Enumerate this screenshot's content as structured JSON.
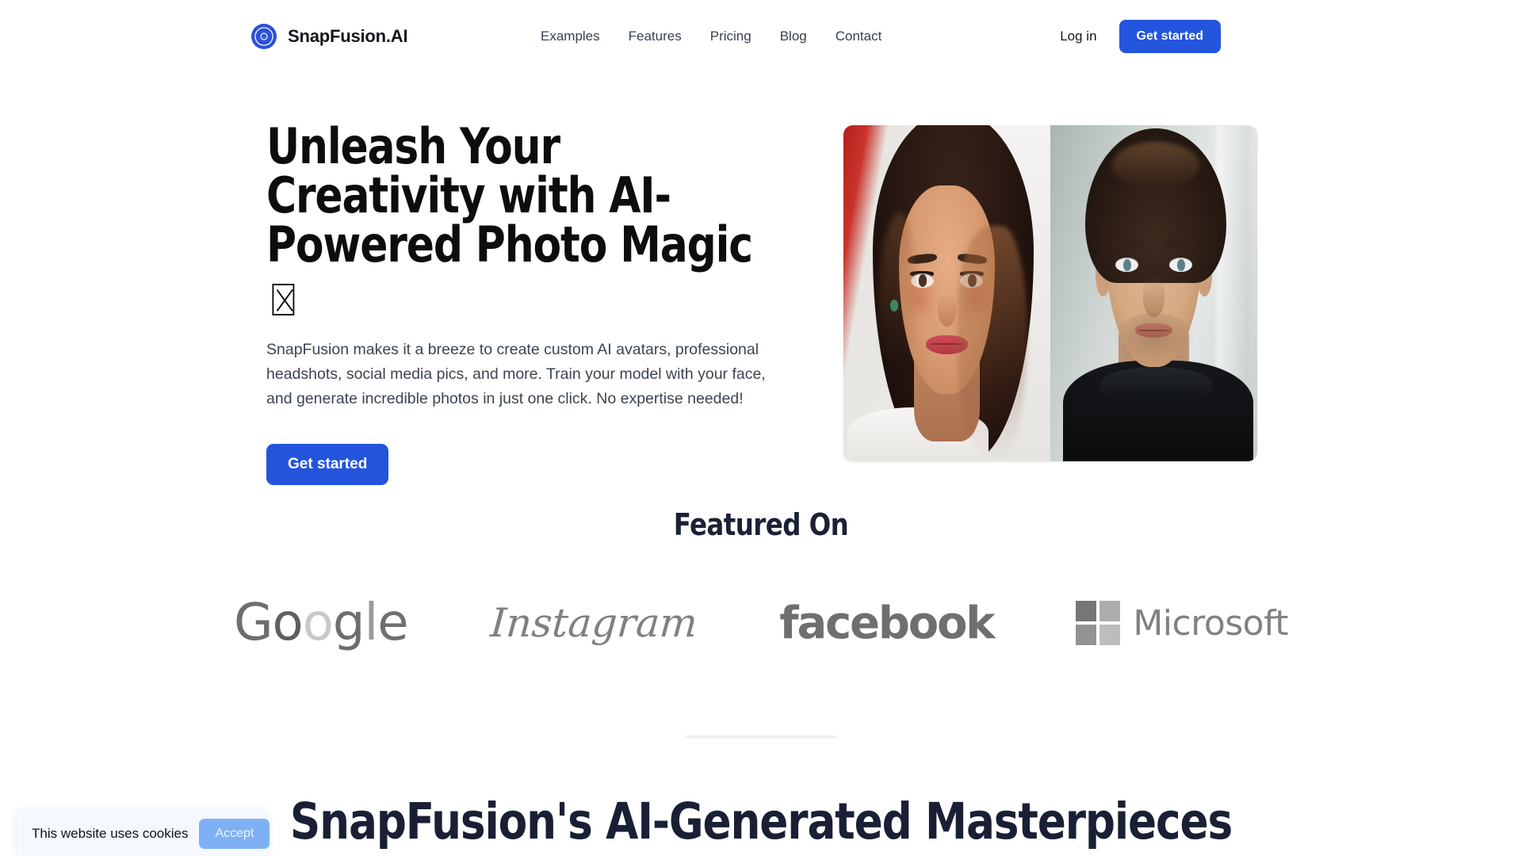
{
  "header": {
    "brand_name": "SnapFusion.AI",
    "brand_icon": "aperture-icon",
    "nav": [
      {
        "label": "Examples"
      },
      {
        "label": "Features"
      },
      {
        "label": "Pricing"
      },
      {
        "label": "Blog"
      },
      {
        "label": "Contact"
      }
    ],
    "login_label": "Log in",
    "cta_label": "Get started"
  },
  "hero": {
    "title": "Unleash Your Creativity with AI-Powered Photo Magic",
    "title_trailing_glyph": "missing-glyph-box",
    "description": "SnapFusion makes it a breeze to create custom AI avatars, professional headshots, social media pics, and more. Train your model with your face, and generate incredible photos in just one click. No expertise needed!",
    "cta_label": "Get started",
    "media_alt": "ai-generated-portraits-pair"
  },
  "featured": {
    "title": "Featured On",
    "logos": [
      {
        "name": "google-logo",
        "text": "Google",
        "letters": [
          "G",
          "o",
          "o",
          "g",
          "l",
          "e"
        ]
      },
      {
        "name": "instagram-logo",
        "text": "Instagram"
      },
      {
        "name": "facebook-logo",
        "text": "facebook"
      },
      {
        "name": "microsoft-logo",
        "text": "Microsoft"
      }
    ]
  },
  "masterpieces": {
    "title": "SnapFusion's AI-Generated Masterpieces"
  },
  "cookie_banner": {
    "message": "This website uses cookies",
    "accept_label": "Accept"
  },
  "colors": {
    "accent_blue": "#2354dc",
    "accept_blue": "#7eb0f5",
    "heading_navy": "#191f35",
    "body_gray": "#3d4451",
    "logo_gray": "#7a7a7a"
  }
}
